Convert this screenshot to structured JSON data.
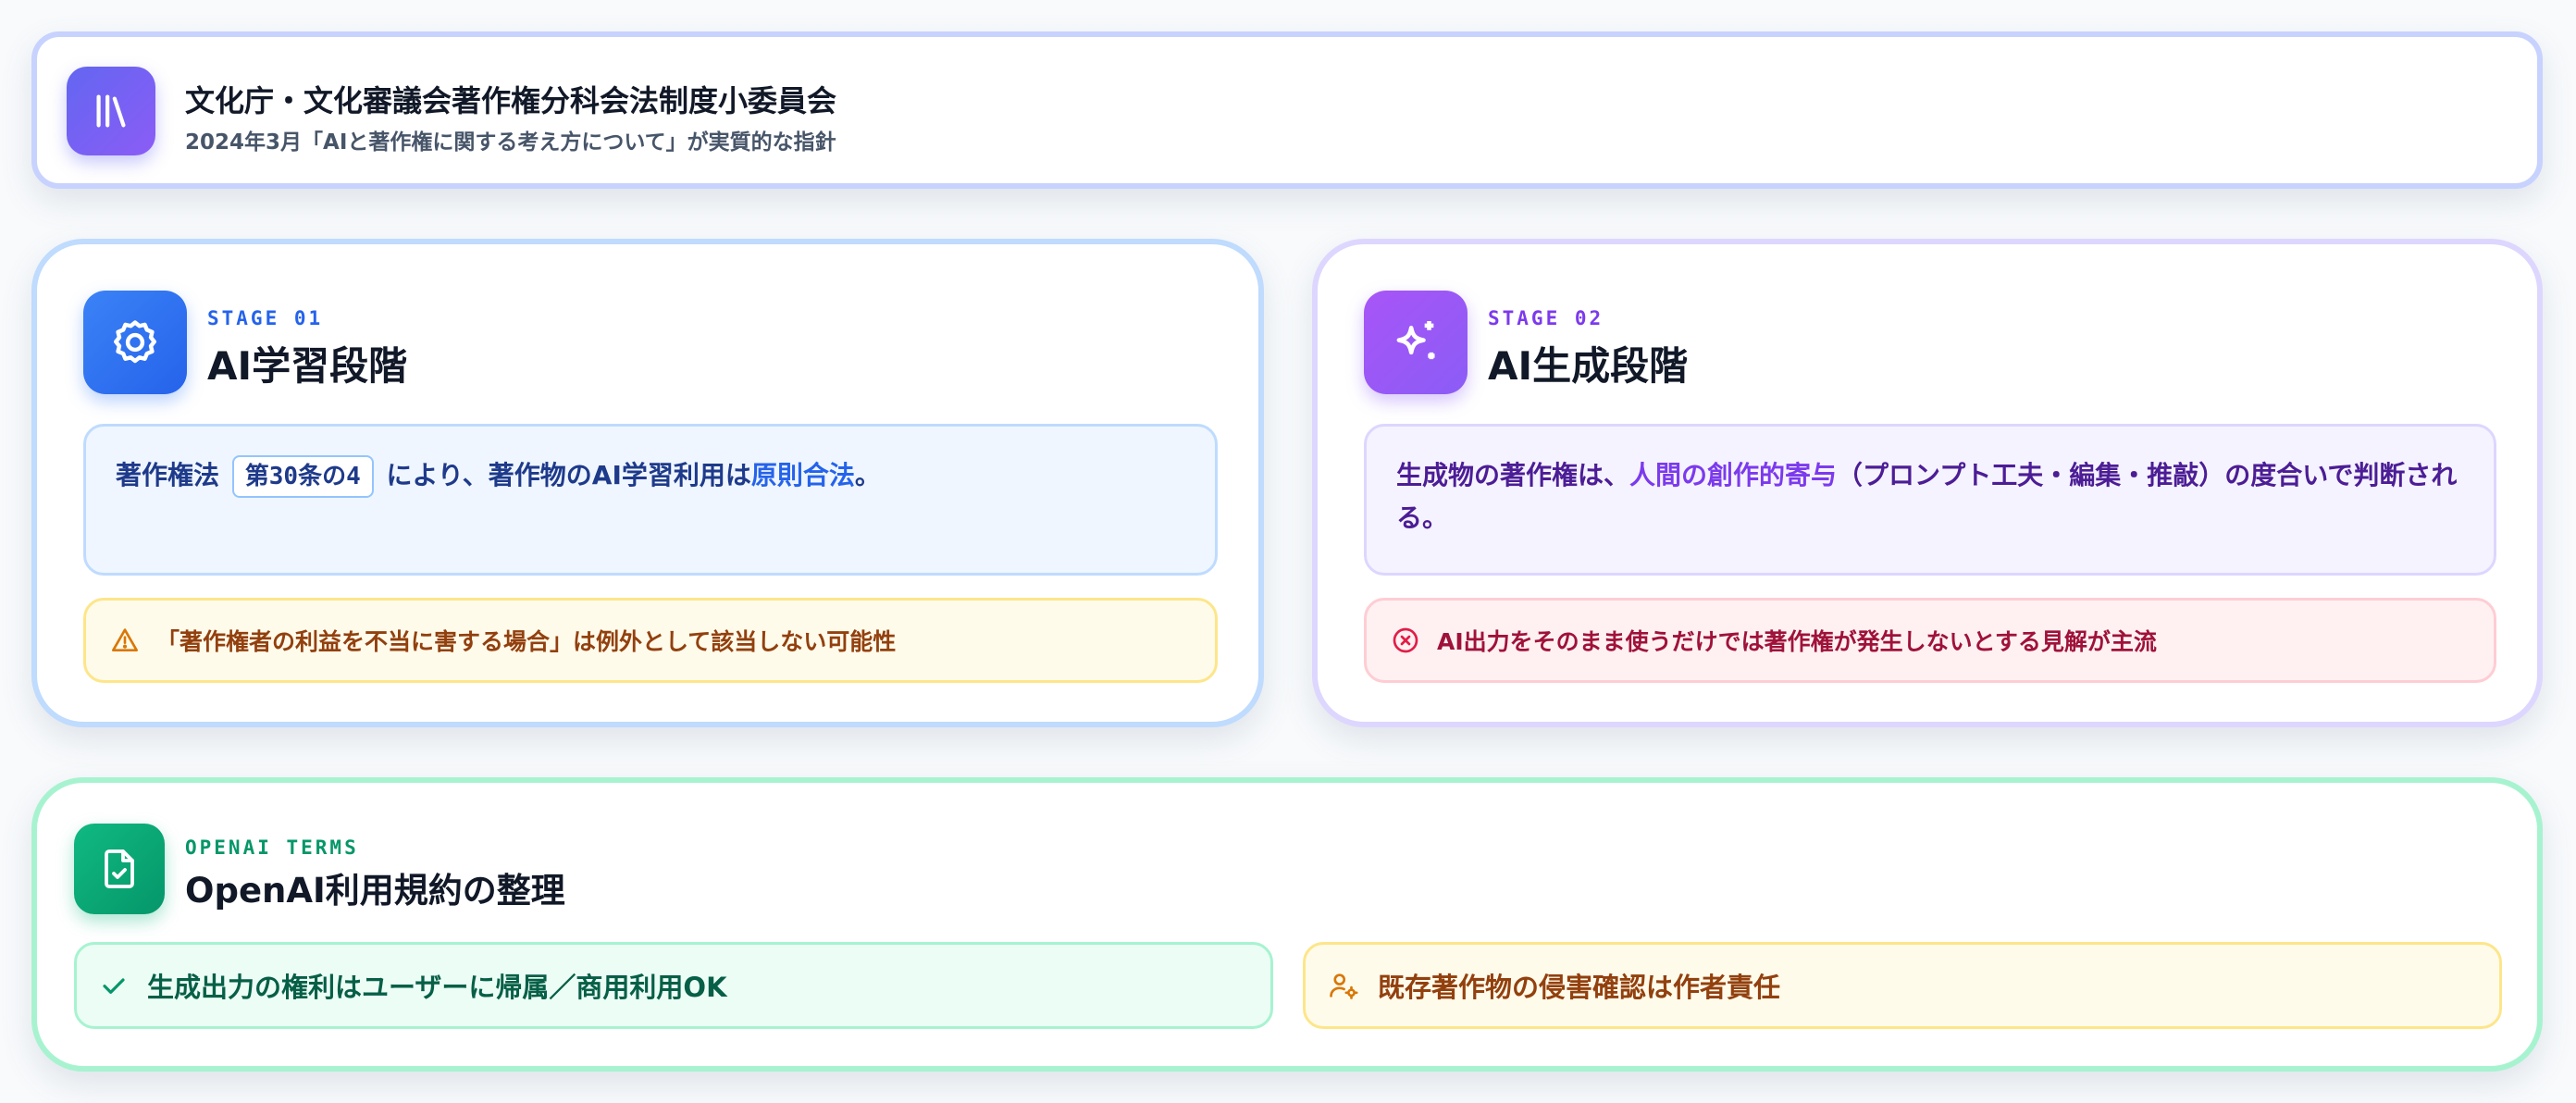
{
  "header": {
    "title": "文化庁・文化審議会著作権分科会法制度小委員会",
    "subtitle": "2024年3月「AIと著作権に関する考え方について」が実質的な指針",
    "icon": "library-icon"
  },
  "stage1": {
    "eyebrow": "STAGE 01",
    "title": "AI学習段階",
    "icon": "gear-icon",
    "info_prefix": "著作権法",
    "info_article": "第30条の4",
    "info_middle": "により、著作物のAI学習利用は",
    "info_accent": "原則合法",
    "info_suffix": "。",
    "warning": "「著作権者の利益を不当に害する場合」は例外として該当しない可能性",
    "warning_icon": "alert-triangle-icon"
  },
  "stage2": {
    "eyebrow": "STAGE 02",
    "title": "AI生成段階",
    "icon": "sparkles-icon",
    "info_prefix": "生成物の著作権は、",
    "info_accent": "人間の創作的寄与",
    "info_suffix": "（プロンプト工夫・編集・推敲）の度合いで判断される。",
    "warning": "AI出力をそのまま使うだけでは著作権が発生しないとする見解が主流",
    "warning_icon": "x-circle-icon"
  },
  "terms": {
    "eyebrow": "OPENAI TERMS",
    "title": "OpenAI利用規約の整理",
    "icon": "file-check-icon",
    "item_ok": "生成出力の権利はユーザーに帰属／商用利用OK",
    "item_ok_icon": "check-icon",
    "item_duty": "既存著作物の侵害確認は作者責任",
    "item_duty_icon": "user-cog-icon"
  },
  "colors": {
    "header_accent": "#6366f1",
    "stage1_accent": "#3b82f6",
    "stage2_accent": "#8b5cf6",
    "terms_accent": "#10b981",
    "warning_yellow": "#d97706",
    "warning_red": "#e11d48"
  }
}
